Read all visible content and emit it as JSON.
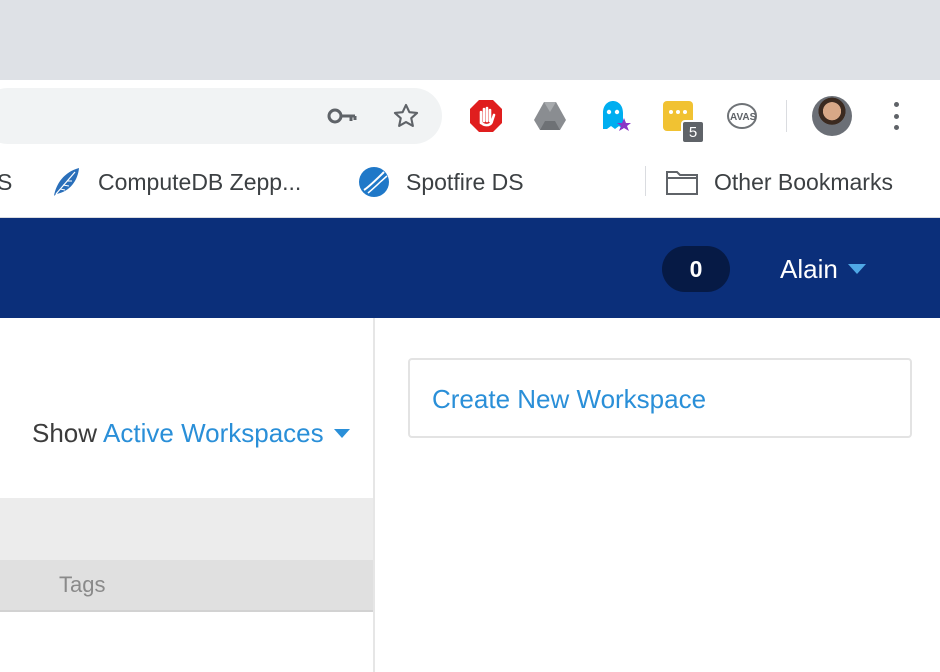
{
  "browser": {
    "extension_badge": "5",
    "bookmarks": [
      {
        "label": "S",
        "icon": "bookmark-favicon"
      },
      {
        "label": "ComputeDB Zepp...",
        "icon": "feather-icon"
      },
      {
        "label": "Spotfire DS",
        "icon": "spotfire-icon"
      },
      {
        "label": "Other Bookmarks",
        "icon": "folder-icon"
      }
    ]
  },
  "app": {
    "notification_count": "0",
    "user_name": "Alain"
  },
  "filter": {
    "prefix": "Show",
    "value": "Active Workspaces"
  },
  "table": {
    "tags_header": "Tags"
  },
  "actions": {
    "create_workspace": "Create New Workspace"
  },
  "colors": {
    "appbar": "#0b2f7a",
    "link": "#2a8fd8",
    "caret": "#4fa8e6"
  }
}
